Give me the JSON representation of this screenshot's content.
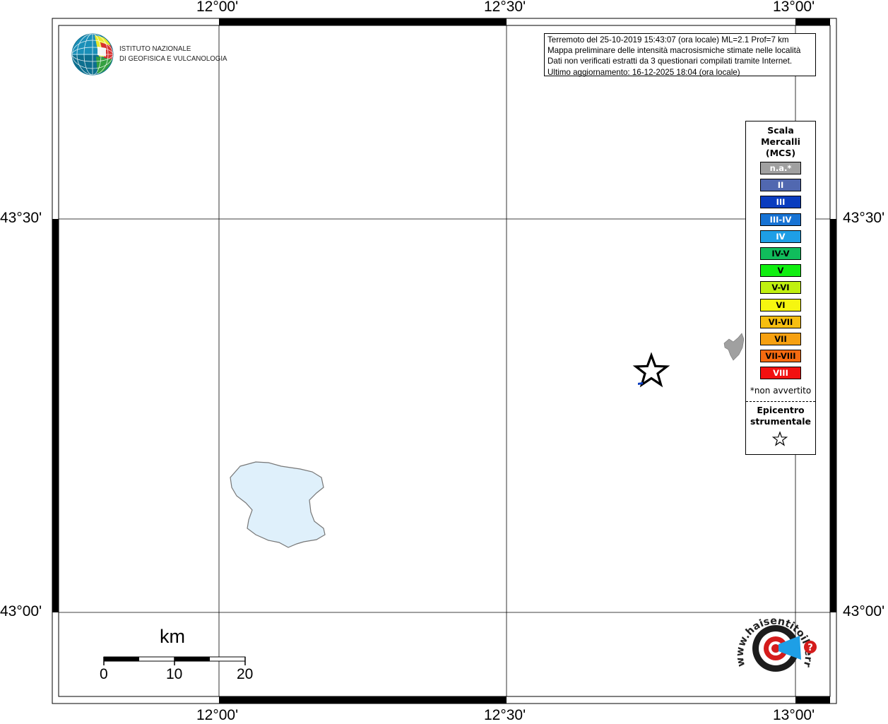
{
  "map": {
    "lon_labels": [
      "12°00'",
      "12°30'",
      "13°00'"
    ],
    "lat_labels": [
      "43°30'",
      "43°00'"
    ]
  },
  "info": {
    "line1": "Terremoto del 25-10-2019 15:43:07 (ora locale) ML=2.1 Prof=7 km",
    "line2": "Mappa preliminare delle intensità macrosismiche stimate nelle località",
    "line3": "Dati non verificati estratti da 3 questionari compilati tramite Internet.",
    "line4": "Ultimo aggiornamento: 16-12-2025 18:04 (ora locale)"
  },
  "logo": {
    "line1": "ISTITUTO NAZIONALE",
    "line2": "DI GEOFISICA E VULCANOLOGIA"
  },
  "legend": {
    "title_line1": "Scala",
    "title_line2": "Mercalli",
    "title_line3": "(MCS)",
    "items": [
      {
        "label": "n.a.*",
        "color": "#a0a0a0",
        "text_color": "#ffffff"
      },
      {
        "label": "II",
        "color": "#5168b0",
        "text_color": "#ffffff"
      },
      {
        "label": "III",
        "color": "#0a3cbf",
        "text_color": "#ffffff"
      },
      {
        "label": "III-IV",
        "color": "#1773d4",
        "text_color": "#ffffff"
      },
      {
        "label": "IV",
        "color": "#1e9fe6",
        "text_color": "#ffffff"
      },
      {
        "label": "IV-V",
        "color": "#10bd5c",
        "text_color": "#000000"
      },
      {
        "label": "V",
        "color": "#10ee10",
        "text_color": "#000000"
      },
      {
        "label": "V-VI",
        "color": "#c0f010",
        "text_color": "#000000"
      },
      {
        "label": "VI",
        "color": "#f6f610",
        "text_color": "#000000"
      },
      {
        "label": "VI-VII",
        "color": "#f6be10",
        "text_color": "#000000"
      },
      {
        "label": "VII",
        "color": "#f6a010",
        "text_color": "#000000"
      },
      {
        "label": "VII-VIII",
        "color": "#f66a10",
        "text_color": "#000000"
      },
      {
        "label": "VIII",
        "color": "#f21010",
        "text_color": "#ffffff"
      }
    ],
    "note": "*non avvertito",
    "epicenter_line1": "Epicentro",
    "epicenter_line2": "strumentale"
  },
  "scale_bar": {
    "unit": "km",
    "ticks": [
      "0",
      "10",
      "20"
    ]
  },
  "hst_logo": {
    "text": "www.haisentitoilterremoto.it"
  },
  "colors": {
    "lake": "#dff0fb",
    "frame": "#000000"
  }
}
